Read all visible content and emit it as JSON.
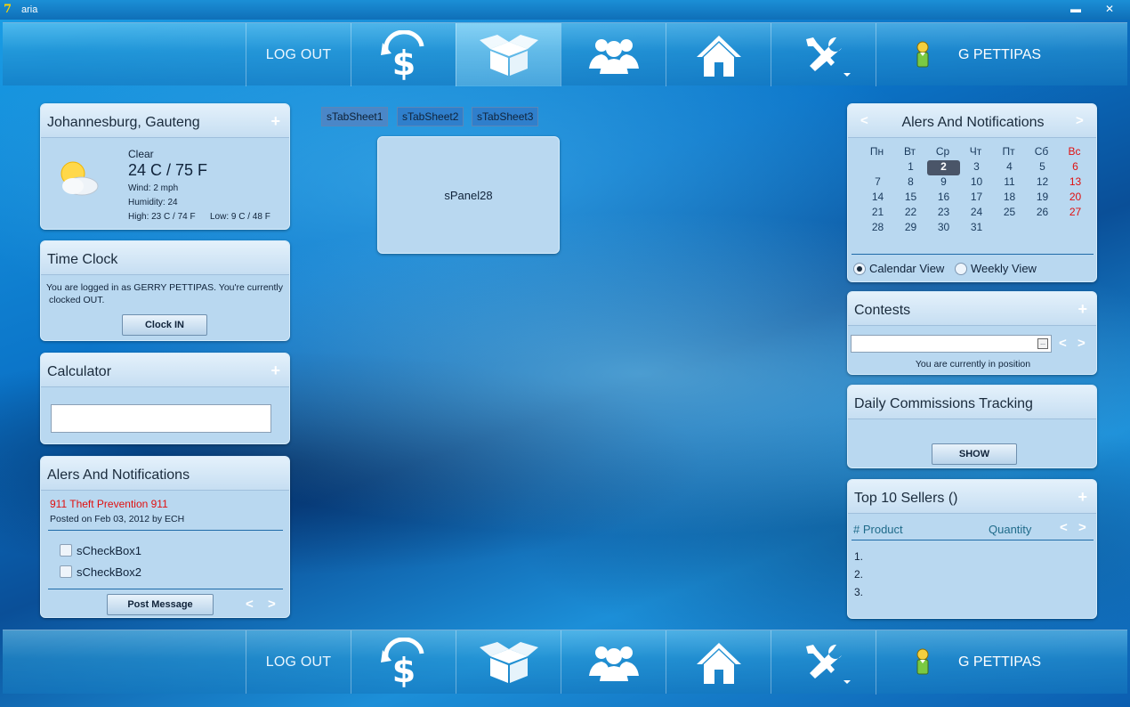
{
  "window": {
    "title": "aria",
    "app_icon_text": "7",
    "min_label": "▬",
    "close_label": "✕"
  },
  "nav": {
    "logout_label": "LOG OUT",
    "user_name": "G PETTIPAS",
    "icons": [
      "dollar-refresh-icon",
      "open-box-icon",
      "people-group-icon",
      "home-icon",
      "tools-icon",
      "user-avatar-icon"
    ]
  },
  "weather": {
    "location": "Johannesburg, Gauteng",
    "condition": "Clear",
    "temp": "24 C / 75 F",
    "wind": "Wind: 2 mph",
    "humidity": "Humidity: 24",
    "high": "High: 23 C / 74 F",
    "low": "Low: 9 C / 48 F"
  },
  "time_clock": {
    "title": "Time Clock",
    "message_line1": "You are logged in as GERRY PETTIPAS. You're currently",
    "message_line2": "clocked OUT.",
    "button_label": "Clock IN"
  },
  "calculator": {
    "title": "Calculator",
    "value": ""
  },
  "alerts_left": {
    "title": "Alers And Notifications",
    "post_title": "911 Theft Prevention 911",
    "post_meta": "Posted on Feb 03, 2012 by ECH",
    "checkbox1": "sCheckBox1",
    "checkbox2": "sCheckBox2",
    "post_button": "Post Message",
    "prev": "<",
    "next": ">"
  },
  "center": {
    "tabs": [
      "sTabSheet1",
      "sTabSheet2",
      "sTabSheet3"
    ],
    "panel_label": "sPanel28"
  },
  "calendar": {
    "title": "Alers And Notifications",
    "prev": "<",
    "next": ">",
    "weekdays": [
      "Пн",
      "Вт",
      "Ср",
      "Чт",
      "Пт",
      "Сб",
      "Вс"
    ],
    "weeks": [
      [
        "",
        "1",
        "2",
        "3",
        "4",
        "5",
        "6"
      ],
      [
        "7",
        "8",
        "9",
        "10",
        "11",
        "12",
        "13"
      ],
      [
        "14",
        "15",
        "16",
        "17",
        "18",
        "19",
        "20"
      ],
      [
        "21",
        "22",
        "23",
        "24",
        "25",
        "26",
        "27"
      ],
      [
        "28",
        "29",
        "30",
        "31",
        "",
        "",
        ""
      ]
    ],
    "today": "2",
    "calendar_view_label": "Calendar View",
    "weekly_view_label": "Weekly View"
  },
  "contests": {
    "title": "Contests",
    "status": "You are currently in position",
    "prev": "<",
    "next": ">"
  },
  "commissions": {
    "title": "Daily Commissions Tracking",
    "button_label": "SHOW"
  },
  "top_sellers": {
    "title": "Top 10 Sellers ()",
    "col_product": "# Product",
    "col_quantity": "Quantity",
    "prev": "<",
    "next": ">",
    "rows": [
      "1.",
      "2.",
      "3."
    ]
  },
  "colors": {
    "accent": "#0b74c8",
    "panel": "#b9d8f0",
    "alert_red": "#e01010"
  }
}
